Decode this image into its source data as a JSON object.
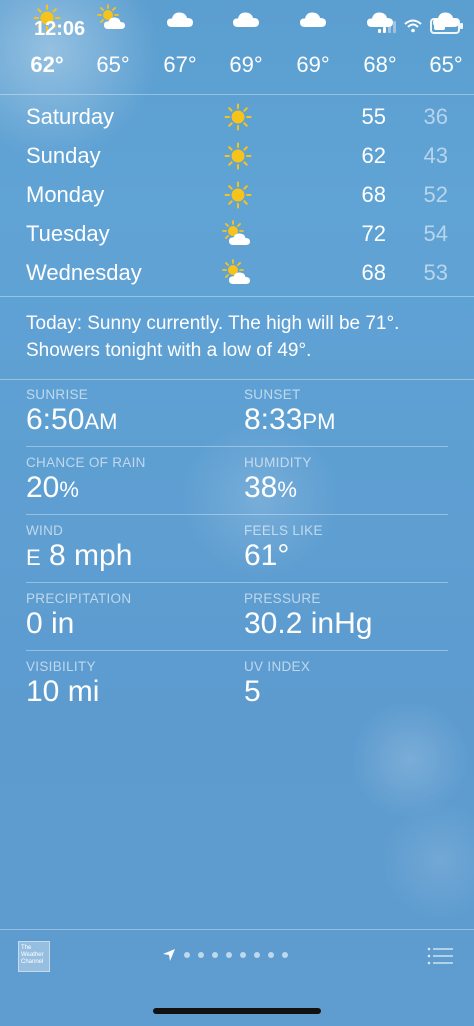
{
  "status_bar": {
    "time": "12:06",
    "signal_bars": 2,
    "battery_level": 0.5
  },
  "hourly": [
    {
      "temp": "62°",
      "icon": "sun-icon",
      "is_now": true
    },
    {
      "temp": "65°",
      "icon": "partly-cloudy-icon",
      "is_now": false
    },
    {
      "temp": "67°",
      "icon": "cloud-icon",
      "is_now": false
    },
    {
      "temp": "69°",
      "icon": "cloud-icon",
      "is_now": false
    },
    {
      "temp": "69°",
      "icon": "cloud-icon",
      "is_now": false
    },
    {
      "temp": "68°",
      "icon": "cloud-icon",
      "is_now": false
    },
    {
      "temp": "65°",
      "icon": "cloud-icon",
      "is_now": false
    }
  ],
  "daily": [
    {
      "day": "Saturday",
      "icon": "sun-icon",
      "high": "55",
      "low": "36"
    },
    {
      "day": "Sunday",
      "icon": "sun-icon",
      "high": "62",
      "low": "43"
    },
    {
      "day": "Monday",
      "icon": "sun-icon",
      "high": "68",
      "low": "52"
    },
    {
      "day": "Tuesday",
      "icon": "partly-cloudy-icon",
      "high": "72",
      "low": "54"
    },
    {
      "day": "Wednesday",
      "icon": "partly-cloudy-icon",
      "high": "68",
      "low": "53"
    }
  ],
  "summary": "Today: Sunny currently. The high will be 71°. Showers tonight with a low of 49°.",
  "details": {
    "sunrise": {
      "label": "SUNRISE",
      "value": "6:50",
      "suffix": "AM"
    },
    "sunset": {
      "label": "SUNSET",
      "value": "8:33",
      "suffix": "PM"
    },
    "chance_of_rain": {
      "label": "CHANCE OF RAIN",
      "value": "20",
      "suffix": "%"
    },
    "humidity": {
      "label": "HUMIDITY",
      "value": "38",
      "suffix": "%"
    },
    "wind": {
      "label": "WIND",
      "prefix": "E",
      "value": " 8 mph"
    },
    "feels_like": {
      "label": "FEELS LIKE",
      "value": "61°"
    },
    "precipitation": {
      "label": "PRECIPITATION",
      "value": "0 in"
    },
    "pressure": {
      "label": "PRESSURE",
      "value": "30.2 inHg"
    },
    "visibility": {
      "label": "VISIBILITY",
      "value": "10 mi"
    },
    "uv_index": {
      "label": "UV INDEX",
      "value": "5"
    }
  },
  "bottom_bar": {
    "logo_text": "The Weather Channel",
    "page_count": 8,
    "icons": [
      "location-arrow-icon",
      "list-icon"
    ]
  },
  "colors": {
    "sun": "#f6c31b",
    "low_temp": "rgba(255,255,255,0.55)"
  }
}
